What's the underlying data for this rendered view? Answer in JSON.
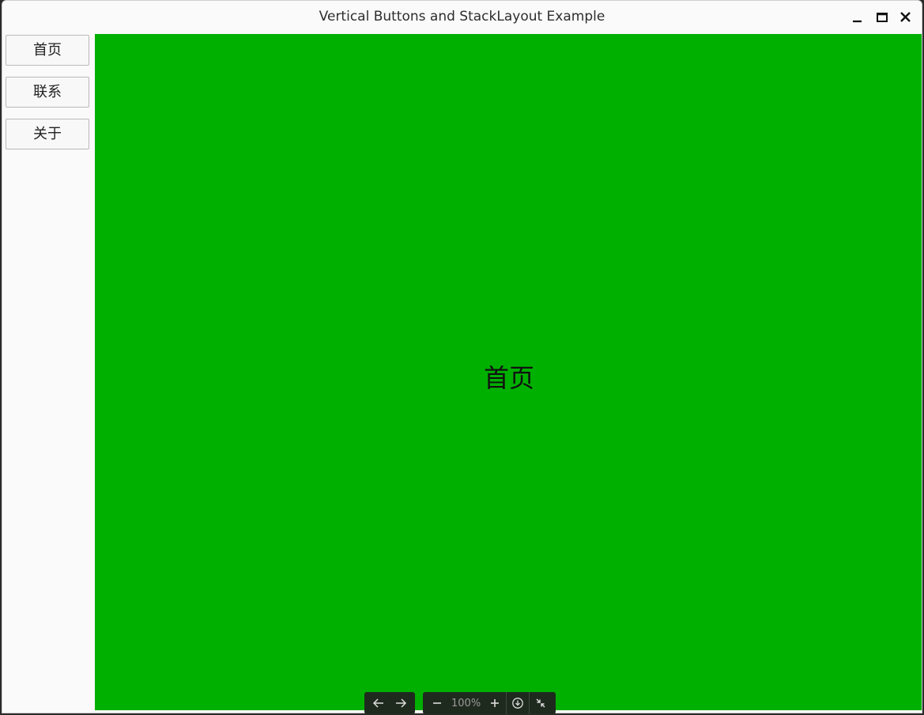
{
  "window": {
    "title": "Vertical Buttons and StackLayout Example",
    "controls": {
      "minimize_icon": "minimize-icon",
      "maximize_icon": "maximize-icon",
      "close_icon": "close-icon"
    }
  },
  "sidebar": {
    "buttons": [
      {
        "label": "首页"
      },
      {
        "label": "联系"
      },
      {
        "label": "关于"
      }
    ]
  },
  "content": {
    "page_label": "首页",
    "background_color": "#00b000"
  },
  "viewer_toolbar": {
    "zoom": "100%",
    "icons": [
      "arrow-left-icon",
      "arrow-right-icon",
      "zoom-out-icon",
      "zoom-in-icon",
      "download-icon",
      "collapse-icon"
    ]
  }
}
